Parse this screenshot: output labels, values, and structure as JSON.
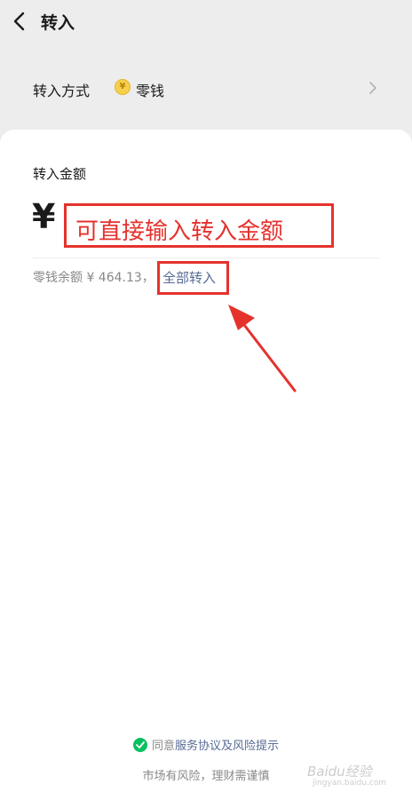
{
  "header": {
    "title": "转入"
  },
  "method": {
    "label": "转入方式",
    "coin_symbol": "¥",
    "value": "零钱"
  },
  "amount": {
    "label": "转入金额",
    "currency": "¥",
    "annotation": "可直接输入转入金额"
  },
  "balance": {
    "text": "零钱余额 ¥ 464.13，",
    "transfer_all": "全部转入"
  },
  "agreement": {
    "prefix": "同意",
    "link": "服务协议及风险提示"
  },
  "risk_note": "市场有风险，理财需谨慎",
  "watermark": {
    "brand": "Baidu经验",
    "url": "jingyan.baidu.com"
  },
  "colors": {
    "annotation_red": "#e5322d",
    "link_blue": "#576b95",
    "check_green": "#07c160"
  }
}
